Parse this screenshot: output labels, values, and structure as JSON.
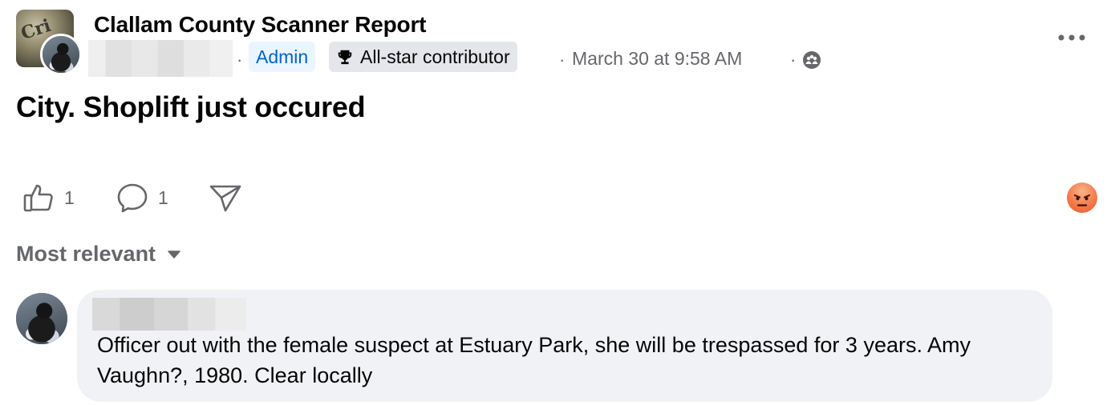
{
  "post": {
    "group_name": "Clallam County Scanner Report",
    "author_name": "",
    "badges": {
      "admin": "Admin",
      "allstar": "All-star contributor"
    },
    "separator": "·",
    "timestamp": "March 30 at 9:58 AM",
    "privacy_icon": "members-icon",
    "text": "City. Shoplift just occured",
    "group_logo_text": "Cri"
  },
  "actions": {
    "like_count": "1",
    "comment_count": "1",
    "share_icon": "share-icon",
    "reaction": "angry-reaction"
  },
  "comments": {
    "sort_label": "Most relevant",
    "items": [
      {
        "author": "",
        "text": "Officer out with the female suspect at Estuary Park, she will be trespassed for 3 years. Amy Vaughn?, 1980. Clear locally"
      }
    ]
  },
  "colors": {
    "text": "#050505",
    "secondary": "#65676b",
    "admin_blue": "#0064d1",
    "admin_bg": "#ebf5ff",
    "badge_bg": "#e4e6eb",
    "bubble_bg": "#f0f2f5"
  }
}
